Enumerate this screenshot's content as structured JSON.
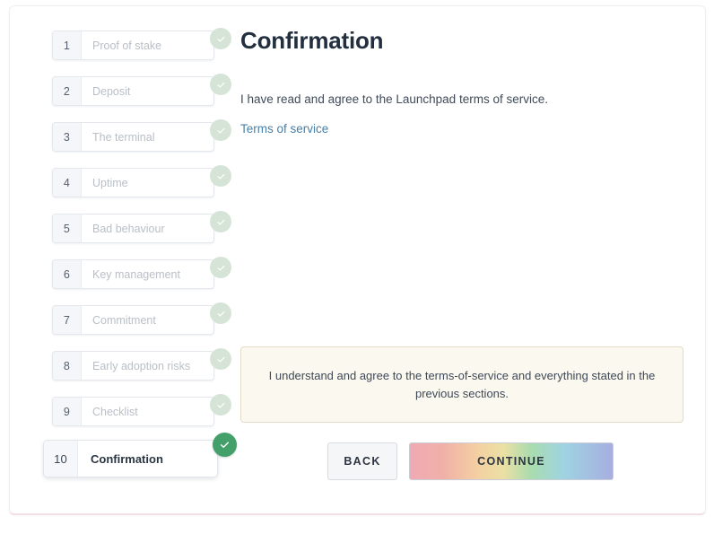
{
  "stepper": {
    "steps": [
      {
        "number": "1",
        "label": "Proof of stake",
        "state": "complete"
      },
      {
        "number": "2",
        "label": "Deposit",
        "state": "complete"
      },
      {
        "number": "3",
        "label": "The terminal",
        "state": "complete"
      },
      {
        "number": "4",
        "label": "Uptime",
        "state": "complete"
      },
      {
        "number": "5",
        "label": "Bad behaviour",
        "state": "complete"
      },
      {
        "number": "6",
        "label": "Key management",
        "state": "complete"
      },
      {
        "number": "7",
        "label": "Commitment",
        "state": "complete"
      },
      {
        "number": "8",
        "label": "Early adoption risks",
        "state": "complete"
      },
      {
        "number": "9",
        "label": "Checklist",
        "state": "complete"
      },
      {
        "number": "10",
        "label": "Confirmation",
        "state": "active"
      }
    ]
  },
  "content": {
    "title": "Confirmation",
    "intro": "I have read and agree to the Launchpad terms of service.",
    "terms_link": "Terms of service"
  },
  "notice": {
    "text": "I understand and agree to the terms-of-service and everything stated in the previous sections."
  },
  "actions": {
    "back_label": "BACK",
    "continue_label": "CONTINUE"
  },
  "colors": {
    "title": "#222f3f",
    "link": "#4a7fa5",
    "check_complete": "#d6e4d8",
    "check_active": "#43a06b",
    "notice_bg": "#fbf8f0",
    "notice_border": "#e3dbc6",
    "back_bg": "#f5f6f8",
    "continue_gradient": "#f0aab4 → #f4cfa2 → #a9dcae → #a7aee0"
  }
}
